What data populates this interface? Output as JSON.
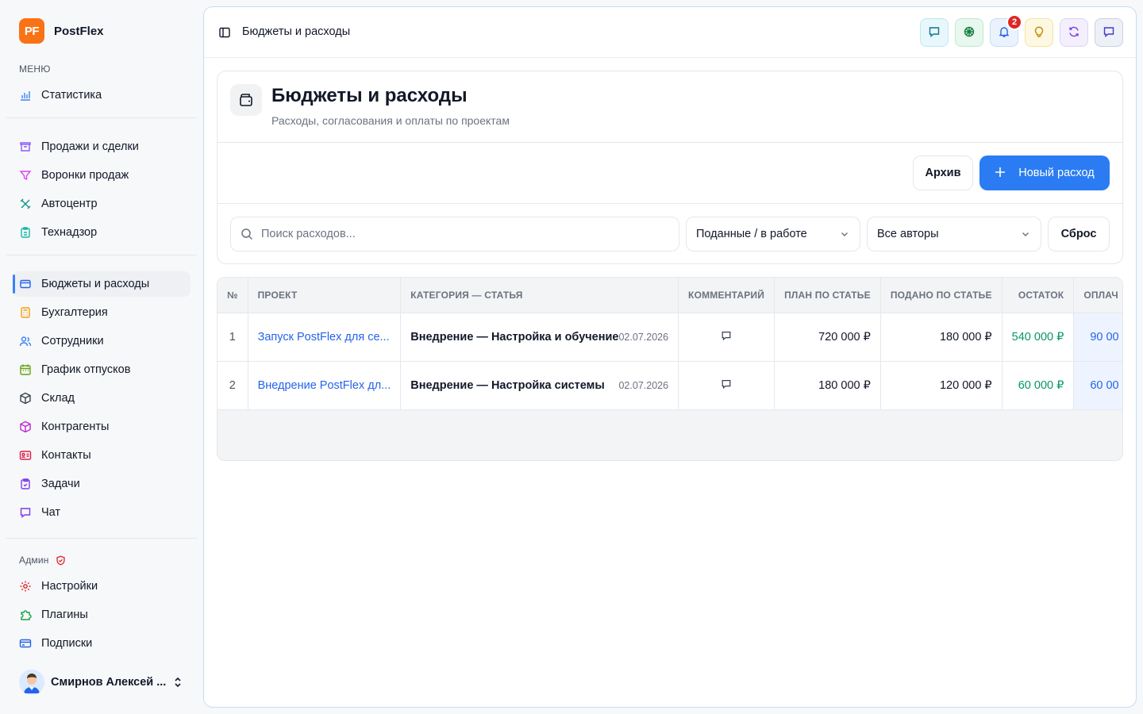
{
  "app": {
    "logo_text": "PF",
    "name": "PostFlex"
  },
  "sidebar": {
    "menu_label": "МЕНЮ",
    "items": [
      {
        "label": "Статистика",
        "icon": "bar-chart-icon"
      },
      {
        "label": "Продажи и сделки",
        "icon": "archive-box-icon"
      },
      {
        "label": "Воронки продаж",
        "icon": "funnel-icon"
      },
      {
        "label": "Автоцентр",
        "icon": "wrench-icon"
      },
      {
        "label": "Технадзор",
        "icon": "clipboard-icon"
      },
      {
        "label": "Бюджеты и расходы",
        "icon": "wallet-icon",
        "active": true
      },
      {
        "label": "Бухгалтерия",
        "icon": "calculator-icon"
      },
      {
        "label": "Сотрудники",
        "icon": "users-icon"
      },
      {
        "label": "График отпусков",
        "icon": "calendar-icon"
      },
      {
        "label": "Склад",
        "icon": "package-icon"
      },
      {
        "label": "Контрагенты",
        "icon": "box-icon"
      },
      {
        "label": "Контакты",
        "icon": "contact-card-icon"
      },
      {
        "label": "Задачи",
        "icon": "tasks-icon"
      },
      {
        "label": "Чат",
        "icon": "chat-icon"
      },
      {
        "label": "Настройки",
        "icon": "gear-icon"
      },
      {
        "label": "Плагины",
        "icon": "puzzle-icon"
      },
      {
        "label": "Подписки",
        "icon": "credit-card-icon"
      }
    ],
    "admin_label": "Админ",
    "user_name": "Смирнов Алексей ..."
  },
  "topbar": {
    "title": "Бюджеты и расходы",
    "notifications_count": "2"
  },
  "page": {
    "title": "Бюджеты и расходы",
    "subtitle": "Расходы, согласования и оплаты по проектам",
    "archive_button": "Архив",
    "new_button": "Новый расход",
    "search_placeholder": "Поиск расходов...",
    "status_filter": "Поданные / в работе",
    "author_filter": "Все авторы",
    "reset_button": "Сброс"
  },
  "table": {
    "headers": [
      "№",
      "Проект",
      "Категория — статья",
      "Комментарий",
      "План по статье",
      "Подано по статье",
      "Остаток",
      "Оплач"
    ],
    "rows": [
      {
        "num": "1",
        "project": "Запуск PostFlex для се...",
        "category": "Внедрение — Настройка и обучение",
        "date": "02.07.2026",
        "plan": "720 000 ₽",
        "submitted": "180 000 ₽",
        "remainder": "540 000 ₽",
        "paid": "90 00"
      },
      {
        "num": "2",
        "project": "Внедрение PostFlex дл...",
        "category": "Внедрение — Настройка системы",
        "date": "02.07.2026",
        "plan": "180 000 ₽",
        "submitted": "120 000 ₽",
        "remainder": "60 000 ₽",
        "paid": "60 00"
      }
    ]
  },
  "colors": {
    "accent": "#2b7cf2",
    "brand": "#f97316",
    "positive": "#059669",
    "badge": "#dc2626"
  }
}
